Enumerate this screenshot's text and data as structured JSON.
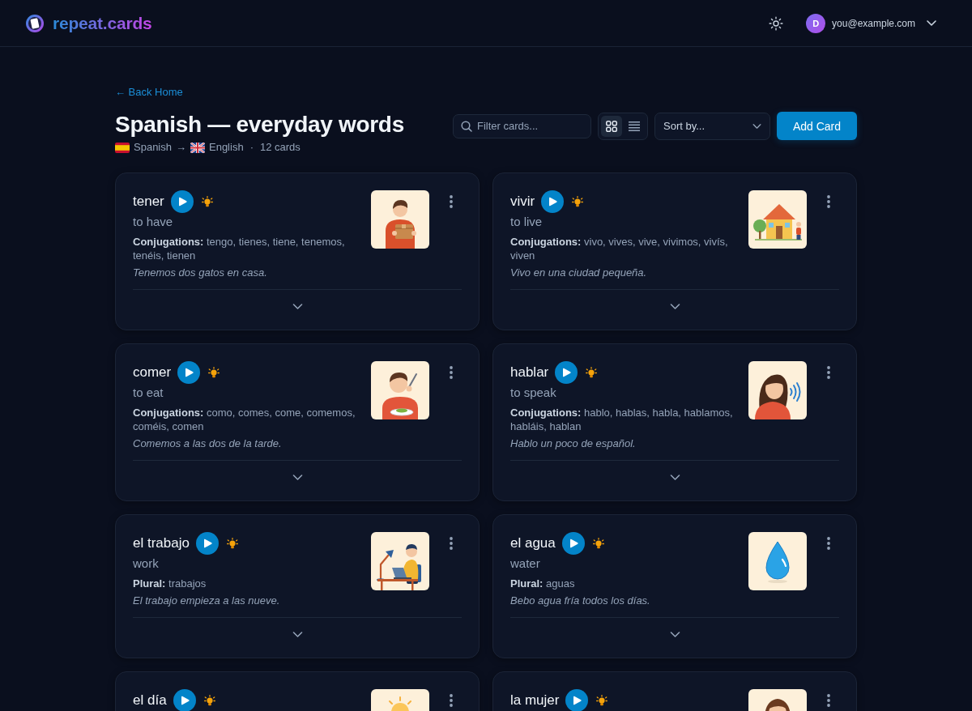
{
  "header": {
    "logo": "repeat.cards",
    "user": {
      "initial": "D",
      "email": "you@example.com"
    }
  },
  "back_link": "← Back Home",
  "deck": {
    "title": "Spanish — everyday words",
    "source_language": "Spanish",
    "arrow": "→",
    "target_language": "English",
    "separator": "·",
    "card_count": "12 cards"
  },
  "toolbar": {
    "search": {
      "placeholder": "Filter cards..."
    },
    "view_modes": [
      {
        "kind": "grid",
        "selected": true
      },
      {
        "kind": "list",
        "selected": false
      }
    ],
    "sort": {
      "label": "Sort by..."
    },
    "add_button": "Add Card"
  },
  "cards": [
    {
      "word": "tener",
      "translation": "to have",
      "detail": "**Conjugations:** tengo, tienes, tiene, tenemos, tenéis, tienen",
      "example": "Tenemos dos gatos en casa.",
      "picture": {
        "kind": "box"
      }
    },
    {
      "word": "vivir",
      "translation": "to live",
      "detail": "**Conjugations:** vivo, vives, vive, vivimos, vivís, viven",
      "example": "Vivo en una ciudad pequeña.",
      "picture": {
        "kind": "house"
      }
    },
    {
      "word": "comer",
      "translation": "to eat",
      "detail": "**Conjugations:** como, comes, come, comemos, coméis, comen",
      "example": "Comemos a las dos de la tarde.",
      "picture": {
        "kind": "eating"
      }
    },
    {
      "word": "hablar",
      "translation": "to speak",
      "detail": "**Conjugations:** hablo, hablas, habla, hablamos, habláis, hablan",
      "example": "Hablo un poco de español.",
      "picture": {
        "kind": "speaking"
      }
    },
    {
      "word": "el trabajo",
      "translation": "work",
      "detail": "**Plural:** trabajos",
      "example": "El trabajo empieza a las nueve.",
      "picture": {
        "kind": "laptop"
      }
    },
    {
      "word": "el agua",
      "translation": "water",
      "detail": "**Plural:** aguas",
      "example": "Bebo agua fría todos los días.",
      "picture": {
        "kind": "drop"
      }
    },
    {
      "word": "el día",
      "picture": {
        "kind": "sun"
      }
    },
    {
      "word": "la mujer",
      "picture": {
        "kind": "woman"
      }
    }
  ]
}
